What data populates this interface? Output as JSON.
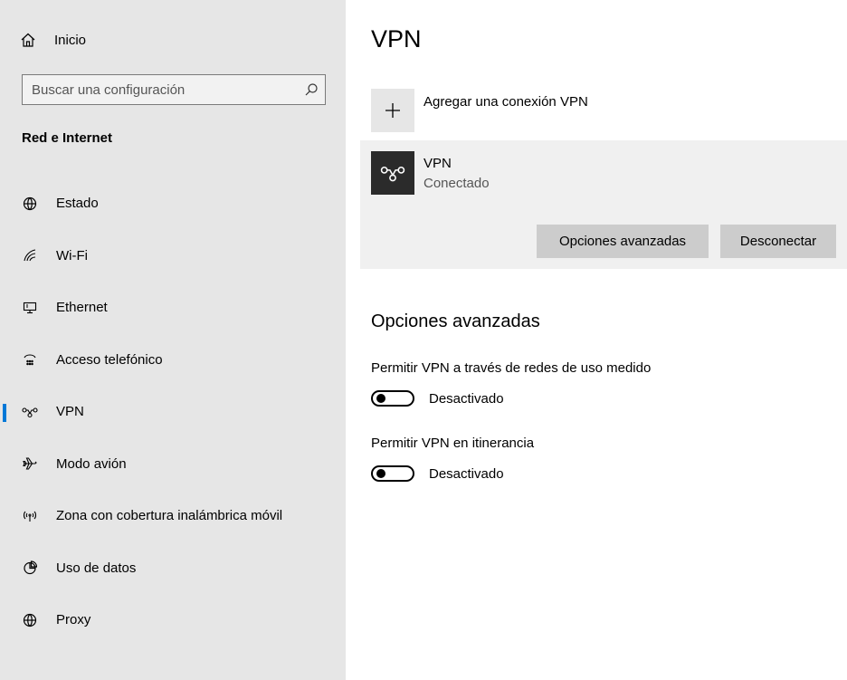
{
  "sidebar": {
    "home": {
      "label": "Inicio",
      "icon": "home-icon"
    },
    "search": {
      "placeholder": "Buscar una configuración",
      "value": "",
      "icon": "search-icon"
    },
    "section_title": "Red e Internet",
    "items": [
      {
        "label": "Estado",
        "icon": "globe-status-icon",
        "active": false
      },
      {
        "label": "Wi-Fi",
        "icon": "wifi-icon",
        "active": false
      },
      {
        "label": "Ethernet",
        "icon": "ethernet-icon",
        "active": false
      },
      {
        "label": "Acceso telefónico",
        "icon": "dialup-icon",
        "active": false
      },
      {
        "label": "VPN",
        "icon": "vpn-icon",
        "active": true
      },
      {
        "label": "Modo avión",
        "icon": "airplane-icon",
        "active": false
      },
      {
        "label": "Zona con cobertura inalámbrica móvil",
        "icon": "hotspot-icon",
        "active": false
      },
      {
        "label": "Uso de datos",
        "icon": "data-usage-icon",
        "active": false
      },
      {
        "label": "Proxy",
        "icon": "globe-icon",
        "active": false
      }
    ]
  },
  "main": {
    "title": "VPN",
    "add_vpn": {
      "label": "Agregar una conexión VPN",
      "icon": "plus-icon"
    },
    "connection": {
      "name": "VPN",
      "status": "Conectado",
      "icon": "vpn-icon",
      "advanced_button": "Opciones avanzadas",
      "disconnect_button": "Desconectar"
    },
    "advanced": {
      "title": "Opciones avanzadas",
      "options": [
        {
          "label": "Permitir VPN a través de redes de uso medido",
          "state": "Desactivado",
          "on": false
        },
        {
          "label": "Permitir VPN en itinerancia",
          "state": "Desactivado",
          "on": false
        }
      ]
    }
  },
  "colors": {
    "sidebar_bg": "#e6e6e6",
    "accent": "#0078d7",
    "card_bg": "#f0f0f0",
    "button_bg": "#cccccc"
  }
}
